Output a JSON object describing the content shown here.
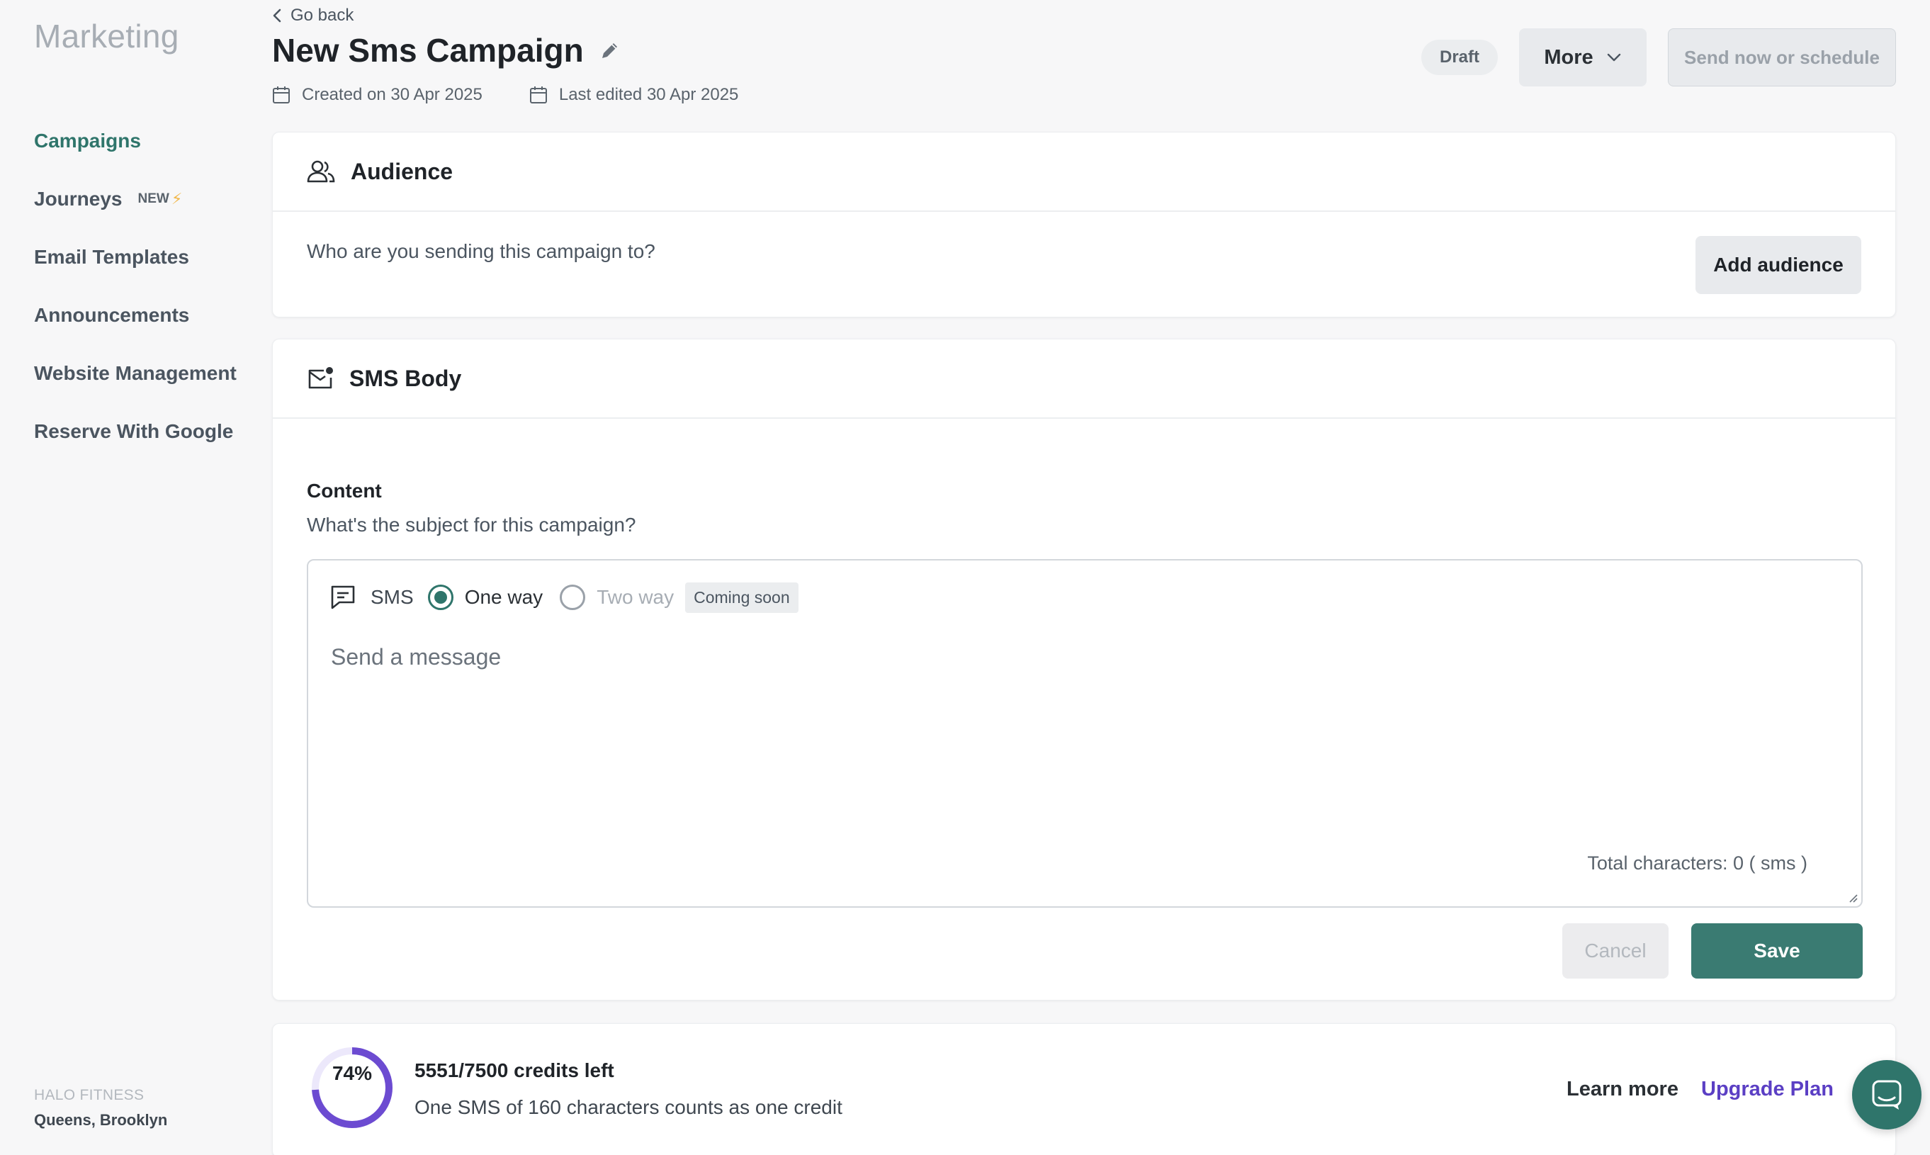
{
  "sidebar": {
    "brand": "Marketing",
    "items": [
      {
        "label": "Campaigns",
        "active": true
      },
      {
        "label": "Journeys",
        "badge": "NEW",
        "badge_icon": "lightning-icon"
      },
      {
        "label": "Email Templates"
      },
      {
        "label": "Announcements"
      },
      {
        "label": "Website Management"
      },
      {
        "label": "Reserve With Google"
      }
    ],
    "org": {
      "name": "HALO FITNESS",
      "location": "Queens, Brooklyn"
    }
  },
  "header": {
    "go_back": "Go back",
    "title": "New Sms Campaign",
    "created": "Created on 30 Apr 2025",
    "edited": "Last edited 30 Apr 2025",
    "status": "Draft",
    "more_label": "More",
    "send_label": "Send now or schedule"
  },
  "audience": {
    "title": "Audience",
    "question": "Who are you sending this campaign to?",
    "add_label": "Add audience"
  },
  "sms_body": {
    "title": "SMS Body",
    "content_label": "Content",
    "content_sub": "What's the subject for this campaign?",
    "channel_label": "SMS",
    "option_one_way": "One way",
    "option_two_way": "Two way",
    "selected_option": "One way",
    "coming_soon": "Coming soon",
    "message_placeholder": "Send a message",
    "message_value": "",
    "char_count": "Total characters: 0 ( sms )",
    "cancel_label": "Cancel",
    "save_label": "Save"
  },
  "credits": {
    "percent": 74,
    "percent_label": "74%",
    "title": "5551/7500 credits left",
    "subtitle": "One SMS of 160 characters counts as one credit",
    "learn_more": "Learn more",
    "upgrade": "Upgrade Plan"
  },
  "colors": {
    "accent": "#2f756b",
    "donut": "#6c4bd1",
    "upgrade_link": "#5b3fc4",
    "save_button": "#3a7b72"
  }
}
